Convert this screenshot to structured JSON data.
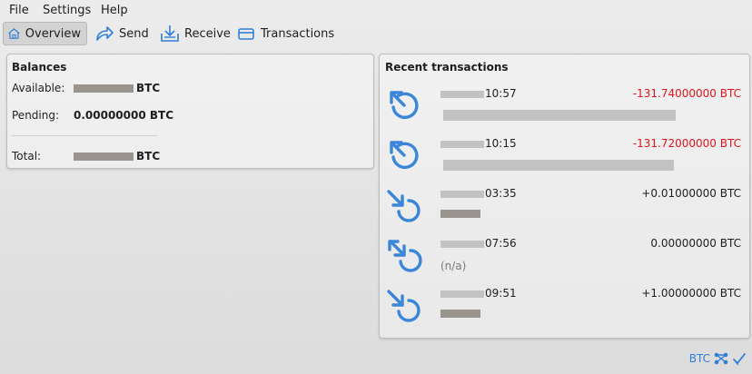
{
  "menu": {
    "file": "File",
    "settings": "Settings",
    "help": "Help"
  },
  "toolbar": {
    "overview": "Overview",
    "send": "Send",
    "receive": "Receive",
    "transactions": "Transactions"
  },
  "balances": {
    "title": "Balances",
    "available_label": "Available:",
    "available_unit": "BTC",
    "pending_label": "Pending:",
    "pending_value": "0.00000000 BTC",
    "total_label": "Total:",
    "total_unit": "BTC"
  },
  "recent": {
    "title": "Recent transactions",
    "items": [
      {
        "time": "10:57",
        "amount": "-131.74000000 BTC",
        "direction": "outgoing",
        "sub": ""
      },
      {
        "time": "10:15",
        "amount": "-131.72000000 BTC",
        "direction": "outgoing",
        "sub": ""
      },
      {
        "time": "03:35",
        "amount": "+0.01000000 BTC",
        "direction": "incoming",
        "sub": ""
      },
      {
        "time": "07:56",
        "amount": "0.00000000 BTC",
        "direction": "self",
        "sub": "(n/a)"
      },
      {
        "time": "09:51",
        "amount": "+1.00000000 BTC",
        "direction": "incoming",
        "sub": ""
      }
    ]
  },
  "status": {
    "unit": "BTC"
  },
  "colors": {
    "accent": "#2f7fd6",
    "negative": "#e0141e",
    "tx_icon": "#3a86d8"
  }
}
